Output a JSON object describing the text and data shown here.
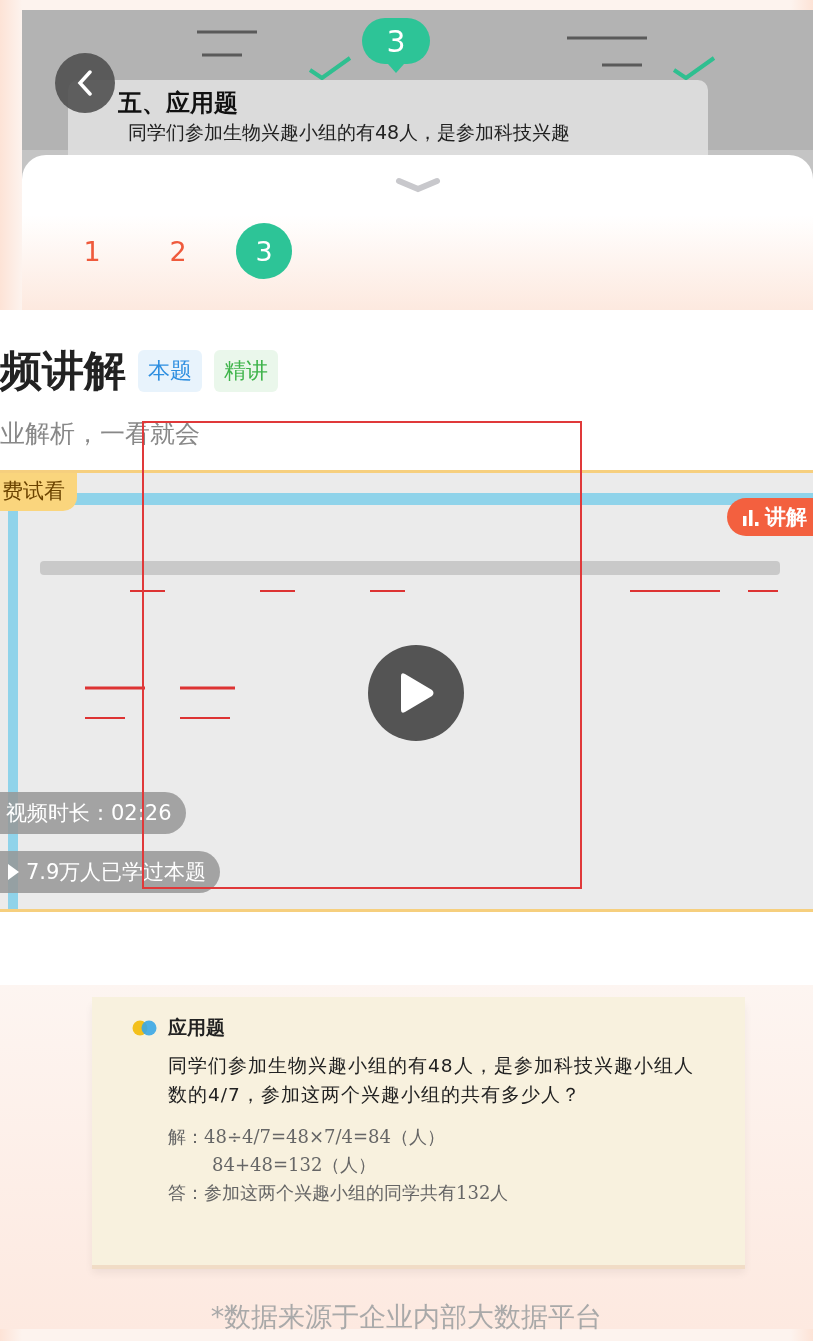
{
  "marker": {
    "label": "3"
  },
  "detected_question": {
    "title": "五、应用题",
    "text": "同学们参加生物兴趣小组的有48人，是参加科技兴趣"
  },
  "question_tabs": [
    {
      "label": "1",
      "selected": false
    },
    {
      "label": "2",
      "selected": false
    },
    {
      "label": "3",
      "selected": true
    }
  ],
  "section": {
    "title": "频讲解",
    "tags": [
      {
        "label": "本题",
        "color": "#2f8fe0"
      },
      {
        "label": "精讲",
        "color": "#3fb44b"
      }
    ],
    "subtitle": "业解析，一看就会"
  },
  "video": {
    "kind": "picture",
    "trial_badge": "费试看",
    "status": "讲解",
    "duration": "视频时长：02:26",
    "learners": "7.9万人已学过本题"
  },
  "answer_card": {
    "title": "应用题",
    "question": "同学们参加生物兴趣小组的有48人，是参加科技兴趣小组人数的4/7，参加这两个兴趣小组的共有多少人？",
    "solution": [
      "解：48÷4/7=48×7/4=84（人）",
      "84+48=132（人）",
      "答：参加这两个兴趣小组的同学共有132人"
    ]
  },
  "footnote": "*数据来源于企业内部大数据平台"
}
